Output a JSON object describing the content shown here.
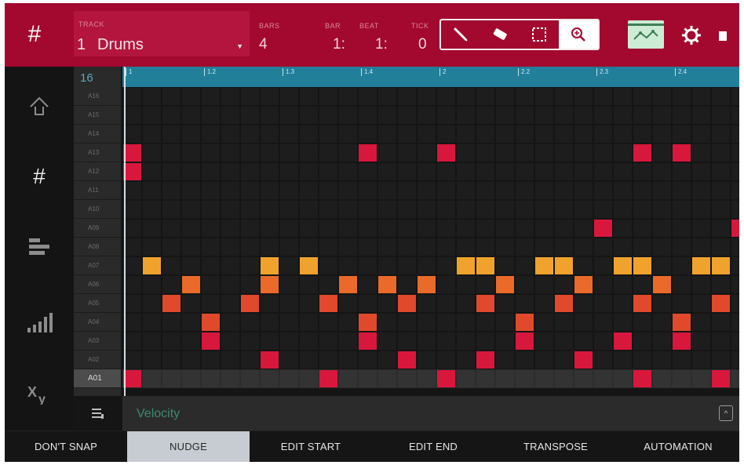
{
  "topbar": {
    "track_label": "TRACK",
    "track_number": "1",
    "track_name": "Drums",
    "fields": [
      {
        "label": "BARS",
        "value": "4"
      },
      {
        "label": "BAR",
        "value": "1:"
      },
      {
        "label": "BEAT",
        "value": "1:"
      },
      {
        "label": "TICK",
        "value": "0"
      }
    ],
    "tools": [
      "pencil-icon",
      "eraser-icon",
      "select-icon",
      "zoom-icon"
    ],
    "active_tool": "zoom-icon",
    "colors": {
      "bar": "#a3082f",
      "automation": "#cdecd5"
    }
  },
  "grid": {
    "zoom": "16",
    "pads": [
      "A16",
      "A15",
      "A14",
      "A13",
      "A12",
      "A11",
      "A10",
      "A09",
      "A08",
      "A07",
      "A06",
      "A05",
      "A04",
      "A03",
      "A02",
      "A01"
    ],
    "selected_pad": "A01",
    "ruler_labels": [
      "1",
      "1.2",
      "1.3",
      "1.4",
      "2",
      "2.2",
      "2.3",
      "2.4"
    ],
    "notes": [
      {
        "pad": "A13",
        "step": 0,
        "color": "#d8173d"
      },
      {
        "pad": "A12",
        "step": 0,
        "color": "#d8173d"
      },
      {
        "pad": "A13",
        "step": 12,
        "color": "#d8173d"
      },
      {
        "pad": "A13",
        "step": 16,
        "color": "#d8173d"
      },
      {
        "pad": "A13",
        "step": 26,
        "color": "#d8173d"
      },
      {
        "pad": "A13",
        "step": 28,
        "color": "#d8173d"
      },
      {
        "pad": "A09",
        "step": 24,
        "color": "#d8173d"
      },
      {
        "pad": "A09",
        "step": 31,
        "color": "#d8173d"
      },
      {
        "pad": "A07",
        "step": 1,
        "color": "#f0a32c"
      },
      {
        "pad": "A07",
        "step": 7,
        "color": "#f0a32c"
      },
      {
        "pad": "A07",
        "step": 9,
        "color": "#f0a32c"
      },
      {
        "pad": "A07",
        "step": 17,
        "color": "#f0a32c"
      },
      {
        "pad": "A07",
        "step": 18,
        "color": "#f0a32c"
      },
      {
        "pad": "A07",
        "step": 21,
        "color": "#f0a32c"
      },
      {
        "pad": "A07",
        "step": 22,
        "color": "#f0a32c"
      },
      {
        "pad": "A07",
        "step": 25,
        "color": "#f0a32c"
      },
      {
        "pad": "A07",
        "step": 26,
        "color": "#f0a32c"
      },
      {
        "pad": "A07",
        "step": 29,
        "color": "#f0a32c"
      },
      {
        "pad": "A07",
        "step": 30,
        "color": "#f0a32c"
      },
      {
        "pad": "A06",
        "step": 3,
        "color": "#e96a2a"
      },
      {
        "pad": "A06",
        "step": 7,
        "color": "#e96a2a"
      },
      {
        "pad": "A06",
        "step": 11,
        "color": "#e96a2a"
      },
      {
        "pad": "A06",
        "step": 13,
        "color": "#e96a2a"
      },
      {
        "pad": "A06",
        "step": 15,
        "color": "#e96a2a"
      },
      {
        "pad": "A06",
        "step": 19,
        "color": "#e96a2a"
      },
      {
        "pad": "A06",
        "step": 23,
        "color": "#e96a2a"
      },
      {
        "pad": "A06",
        "step": 27,
        "color": "#e96a2a"
      },
      {
        "pad": "A05",
        "step": 2,
        "color": "#e0492c"
      },
      {
        "pad": "A05",
        "step": 6,
        "color": "#e0492c"
      },
      {
        "pad": "A05",
        "step": 10,
        "color": "#e0492c"
      },
      {
        "pad": "A05",
        "step": 14,
        "color": "#e0492c"
      },
      {
        "pad": "A05",
        "step": 18,
        "color": "#e0492c"
      },
      {
        "pad": "A05",
        "step": 22,
        "color": "#e0492c"
      },
      {
        "pad": "A05",
        "step": 26,
        "color": "#e0492c"
      },
      {
        "pad": "A05",
        "step": 30,
        "color": "#e0492c"
      },
      {
        "pad": "A04",
        "step": 4,
        "color": "#e0492c"
      },
      {
        "pad": "A04",
        "step": 12,
        "color": "#e0492c"
      },
      {
        "pad": "A04",
        "step": 20,
        "color": "#e0492c"
      },
      {
        "pad": "A04",
        "step": 28,
        "color": "#e0492c"
      },
      {
        "pad": "A03",
        "step": 4,
        "color": "#d8173d"
      },
      {
        "pad": "A03",
        "step": 12,
        "color": "#d8173d"
      },
      {
        "pad": "A03",
        "step": 20,
        "color": "#d8173d"
      },
      {
        "pad": "A03",
        "step": 25,
        "color": "#d8173d"
      },
      {
        "pad": "A03",
        "step": 28,
        "color": "#d8173d"
      },
      {
        "pad": "A02",
        "step": 7,
        "color": "#d8173d"
      },
      {
        "pad": "A02",
        "step": 14,
        "color": "#d8173d"
      },
      {
        "pad": "A02",
        "step": 18,
        "color": "#d8173d"
      },
      {
        "pad": "A02",
        "step": 23,
        "color": "#d8173d"
      },
      {
        "pad": "A01",
        "step": 0,
        "color": "#d8173d"
      },
      {
        "pad": "A01",
        "step": 10,
        "color": "#d8173d"
      },
      {
        "pad": "A01",
        "step": 16,
        "color": "#d8173d"
      },
      {
        "pad": "A01",
        "step": 26,
        "color": "#d8173d"
      },
      {
        "pad": "A01",
        "step": 30,
        "color": "#d8173d"
      }
    ]
  },
  "velocity": {
    "label": "Velocity",
    "toggle": "^"
  },
  "bottom": {
    "buttons": [
      "DON'T SNAP",
      "NUDGE",
      "EDIT START",
      "EDIT END",
      "TRANSPOSE",
      "AUTOMATION"
    ],
    "active": "NUDGE"
  }
}
